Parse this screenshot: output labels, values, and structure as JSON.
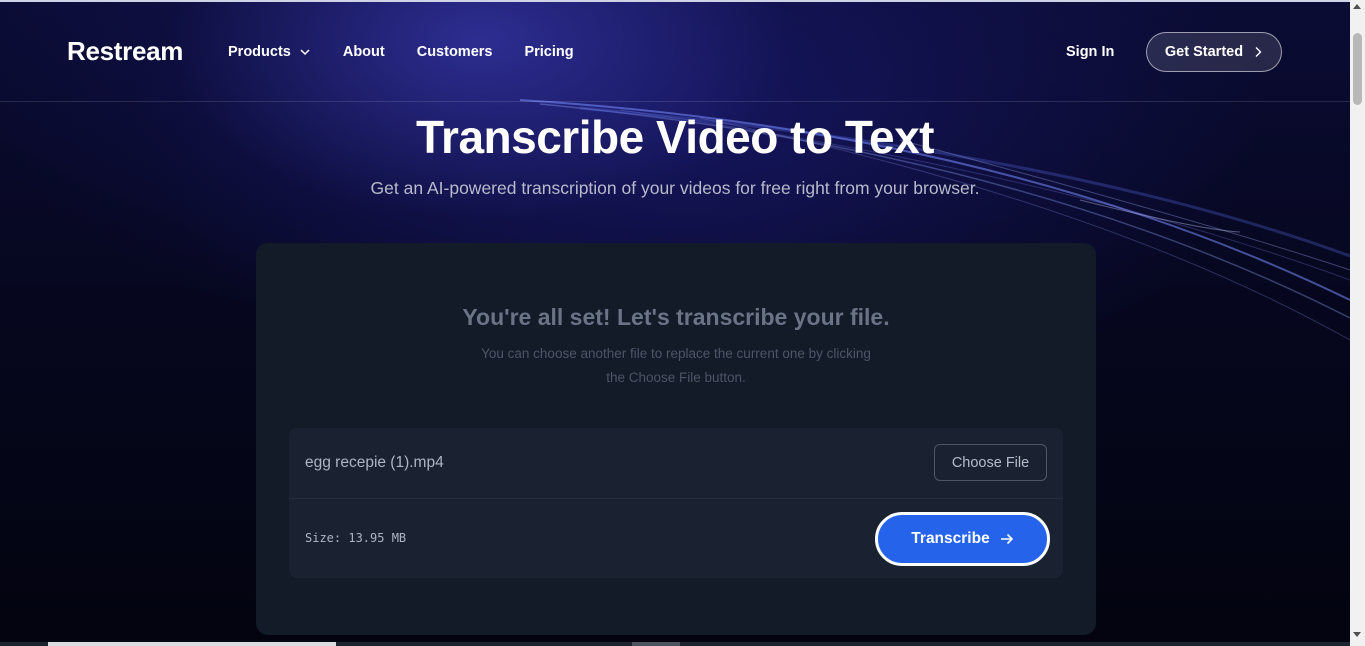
{
  "header": {
    "logo": "Restream",
    "nav": [
      {
        "label": "Products",
        "has_dropdown": true
      },
      {
        "label": "About"
      },
      {
        "label": "Customers"
      },
      {
        "label": "Pricing"
      }
    ],
    "sign_in": "Sign In",
    "get_started": "Get Started"
  },
  "hero": {
    "title": "Transcribe Video to Text",
    "subtitle": "Get an AI-powered transcription of your videos for free right from your browser."
  },
  "card": {
    "title": "You're all set! Let's transcribe your file.",
    "description": "You can choose another file to replace the current one by clicking the Choose File button.",
    "file_name": "egg recepie (1).mp4",
    "choose_file": "Choose File",
    "size": "Size: 13.95 MB",
    "transcribe": "Transcribe"
  },
  "colors": {
    "accent": "#2563eb",
    "background": "#05061a",
    "card": "#131a28"
  }
}
